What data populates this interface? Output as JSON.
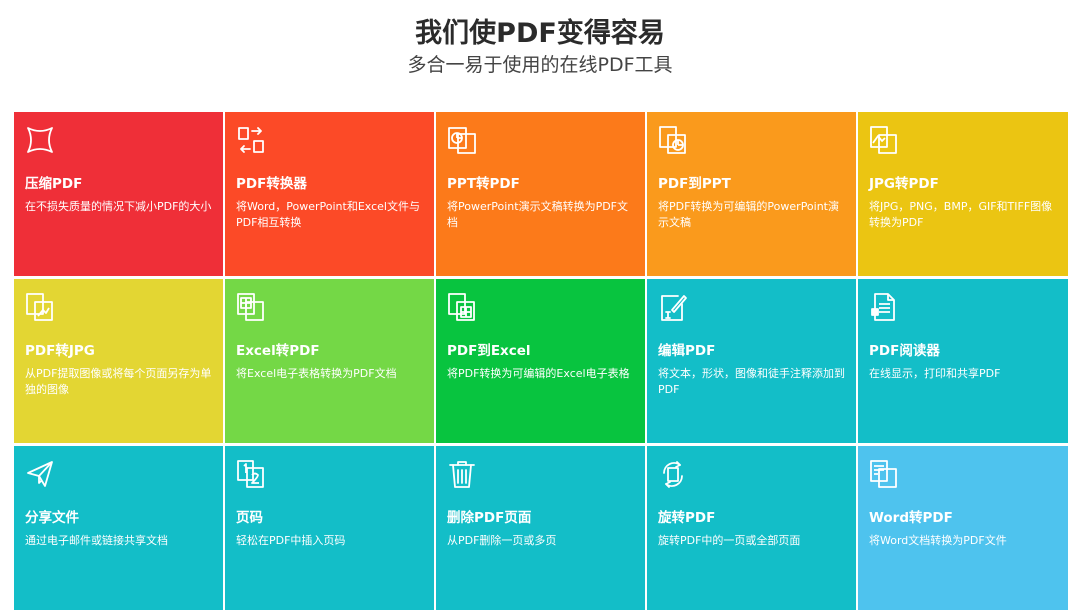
{
  "header": {
    "title": "我们使PDF变得容易",
    "subtitle": "多合一易于使用的在线PDF工具"
  },
  "tools": [
    {
      "title": "压缩PDF",
      "desc": "在不损失质量的情况下减小PDF的大小",
      "color": "#ef2f38",
      "icon": "compress-icon"
    },
    {
      "title": "PDF转换器",
      "desc": "将Word，PowerPoint和Excel文件与PDF相互转换",
      "color": "#fc4a27",
      "icon": "convert-icon"
    },
    {
      "title": "PPT转PDF",
      "desc": "将PowerPoint演示文稿转换为PDF文档",
      "color": "#fc7a1a",
      "icon": "ppt-to-pdf-icon"
    },
    {
      "title": "PDF到PPT",
      "desc": "将PDF转换为可编辑的PowerPoint演示文稿",
      "color": "#fa9a1c",
      "icon": "pdf-to-ppt-icon"
    },
    {
      "title": "JPG转PDF",
      "desc": "将JPG，PNG，BMP，GIF和TIFF图像转换为PDF",
      "color": "#ebc512",
      "icon": "jpg-to-pdf-icon"
    },
    {
      "title": "PDF转JPG",
      "desc": "从PDF提取图像或将每个页面另存为单独的图像",
      "color": "#e3d633",
      "icon": "pdf-to-jpg-icon"
    },
    {
      "title": "Excel转PDF",
      "desc": "将Excel电子表格转换为PDF文档",
      "color": "#74d846",
      "icon": "excel-to-pdf-icon"
    },
    {
      "title": "PDF到Excel",
      "desc": "将PDF转换为可编辑的Excel电子表格",
      "color": "#08c43f",
      "icon": "pdf-to-excel-icon"
    },
    {
      "title": "编辑PDF",
      "desc": "将文本，形状，图像和徒手注释添加到PDF",
      "color": "#13bec8",
      "icon": "edit-pdf-icon"
    },
    {
      "title": "PDF阅读器",
      "desc": "在线显示，打印和共享PDF",
      "color": "#13bec8",
      "icon": "pdf-reader-icon"
    },
    {
      "title": "分享文件",
      "desc": "通过电子邮件或链接共享文档",
      "color": "#13bec8",
      "icon": "share-icon"
    },
    {
      "title": "页码",
      "desc": "轻松在PDF中插入页码",
      "color": "#13bec8",
      "icon": "page-number-icon"
    },
    {
      "title": "删除PDF页面",
      "desc": "从PDF删除一页或多页",
      "color": "#13bec8",
      "icon": "trash-icon"
    },
    {
      "title": "旋转PDF",
      "desc": "旋转PDF中的一页或全部页面",
      "color": "#13bec8",
      "icon": "rotate-icon"
    },
    {
      "title": "Word转PDF",
      "desc": "将Word文档转换为PDF文件",
      "color": "#4ec3ee",
      "icon": "word-to-pdf-icon"
    }
  ]
}
